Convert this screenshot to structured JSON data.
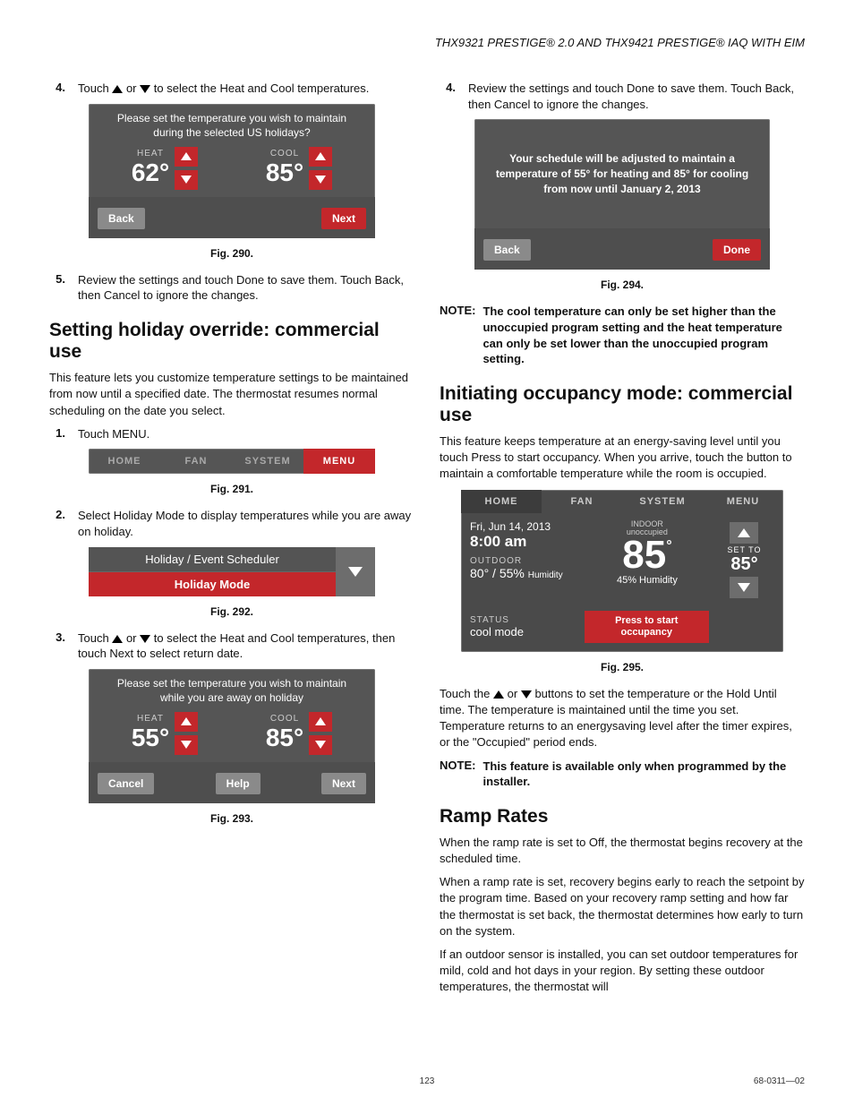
{
  "header": {
    "line": "THX9321 PRESTIGE® 2.0 AND THX9421 PRESTIGE® IAQ WITH EIM"
  },
  "left": {
    "step4": {
      "num": "4.",
      "pre": "Touch",
      "mid": "or",
      "post": "to select the Heat and Cool temperatures."
    },
    "fig290": {
      "msg": "Please set the temperature you wish to maintain during the selected US holidays?",
      "heat_lbl": "HEAT",
      "heat_val": "62°",
      "cool_lbl": "COOL",
      "cool_val": "85°",
      "back": "Back",
      "next": "Next",
      "cap": "Fig. 290."
    },
    "step5": {
      "num": "5.",
      "txt": "Review the settings and touch Done to save them. Touch Back, then Cancel to ignore the changes."
    },
    "sec1": {
      "title": "Setting holiday override: commercial use",
      "para": "This feature lets you customize temperature settings to be maintained from now until a specified date. The thermostat resumes normal scheduling on the date you select.",
      "step1": {
        "num": "1.",
        "txt": "Touch MENU."
      },
      "step2": {
        "num": "2.",
        "txt": "Select Holiday Mode to display temperatures while you are away on holiday."
      },
      "step3": {
        "num": "3.",
        "pre": "Touch",
        "mid": "or",
        "post": "to select the Heat and Cool temperatures, then touch Next to select return date."
      }
    },
    "fig291": {
      "home": "HOME",
      "fan": "FAN",
      "system": "SYSTEM",
      "menu": "MENU",
      "cap": "Fig. 291."
    },
    "fig292": {
      "row1": "Holiday / Event Scheduler",
      "row2": "Holiday Mode",
      "cap": "Fig. 292."
    },
    "fig293": {
      "msg": "Please set the temperature you wish to maintain while you are away on holiday",
      "heat_lbl": "HEAT",
      "heat_val": "55°",
      "cool_lbl": "COOL",
      "cool_val": "85°",
      "cancel": "Cancel",
      "help": "Help",
      "next": "Next",
      "cap": "Fig. 293."
    }
  },
  "right": {
    "step4": {
      "num": "4.",
      "txt": "Review the settings and touch Done to save them. Touch Back, then Cancel to ignore the changes."
    },
    "fig294": {
      "msg": "Your schedule will be adjusted to maintain a temperature of 55° for heating and 85° for cooling from now until January 2, 2013",
      "back": "Back",
      "done": "Done",
      "cap": "Fig. 294."
    },
    "note1": {
      "lbl": "NOTE:",
      "txt": "The cool temperature can only be set higher than the unoccupied program setting and the heat temperature can only be set lower than the unoccupied program setting."
    },
    "sec2": {
      "title": "Initiating occupancy mode: commercial use",
      "para": "This feature keeps temperature at an energy-saving level until you touch Press to start occupancy. When you arrive, touch the button to maintain a comfortable temperature while the room is occupied."
    },
    "fig295": {
      "tabs": {
        "home": "HOME",
        "fan": "FAN",
        "system": "SYSTEM",
        "menu": "MENU"
      },
      "date": "Fri, Jun 14, 2013",
      "time": "8:00 am",
      "outdoor_lbl": "OUTDOOR",
      "outdoor_val": "80° / 55%",
      "hum_word": "Humidity",
      "indoor_lbl": "INDOOR",
      "indoor_state": "unoccupied",
      "indoor_temp": "85",
      "deg": "°",
      "indoor_hum": "45% Humidity",
      "setto": "SET TO",
      "setval": "85°",
      "status_lbl": "STATUS",
      "status_val": "cool mode",
      "press": "Press to start occupancy",
      "cap": "Fig. 295."
    },
    "para295a": "Touch the",
    "para295b": "or",
    "para295c": "buttons to set the temperature or the Hold Until time. The temperature is maintained until the time you set. Temperature returns to an energysaving level after the timer expires, or the \"Occupied\" period ends.",
    "note2": {
      "lbl": "NOTE:",
      "txt": "This feature is available only when programmed by the installer."
    },
    "sec3": {
      "title": "Ramp Rates",
      "p1": "When the ramp rate is set to Off, the thermostat begins recovery at the scheduled time.",
      "p2": "When a ramp rate is set, recovery begins early to reach the setpoint by the program time. Based on your recovery ramp setting and how far the thermostat is set back, the thermostat determines how early to turn on the system.",
      "p3": "If an outdoor sensor is installed, you can set outdoor temperatures for mild, cold and hot days in your region. By setting these outdoor temperatures, the thermostat will"
    }
  },
  "footer": {
    "page": "123",
    "doc": "68-0311—02"
  }
}
